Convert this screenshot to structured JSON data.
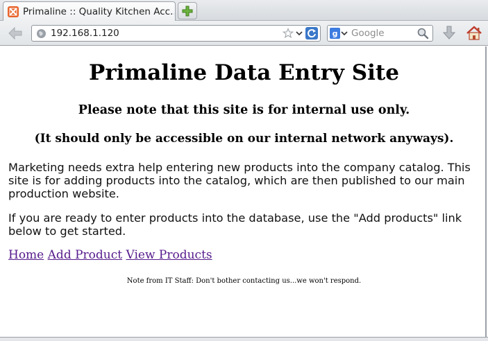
{
  "browser": {
    "tab": {
      "title": "Primaline :: Quality Kitchen Acc..."
    },
    "url": "192.168.1.120",
    "search": {
      "engine_letter": "g",
      "placeholder": "Google"
    }
  },
  "page": {
    "heading": "Primaline Data Entry Site",
    "notice": "Please note that this site is for internal use only.",
    "subnotice": "(It should only be accessible on our internal network anyways).",
    "paragraph1": "Marketing needs extra help entering new products into the company catalog. This site is for adding products into the catalog, which are then published to our main production website.",
    "paragraph2": "If you are ready to enter products into the database, use the \"Add products\" link below to get started.",
    "links": {
      "home": "Home",
      "add_product": "Add Product",
      "view_products": "View Products"
    },
    "footer_note": "Note from IT Staff: Don't bother contacting us...we won't respond."
  },
  "colors": {
    "link_visited": "#551a8b",
    "favicon": "#e8632b",
    "search_engine": "#3d7ce0"
  }
}
